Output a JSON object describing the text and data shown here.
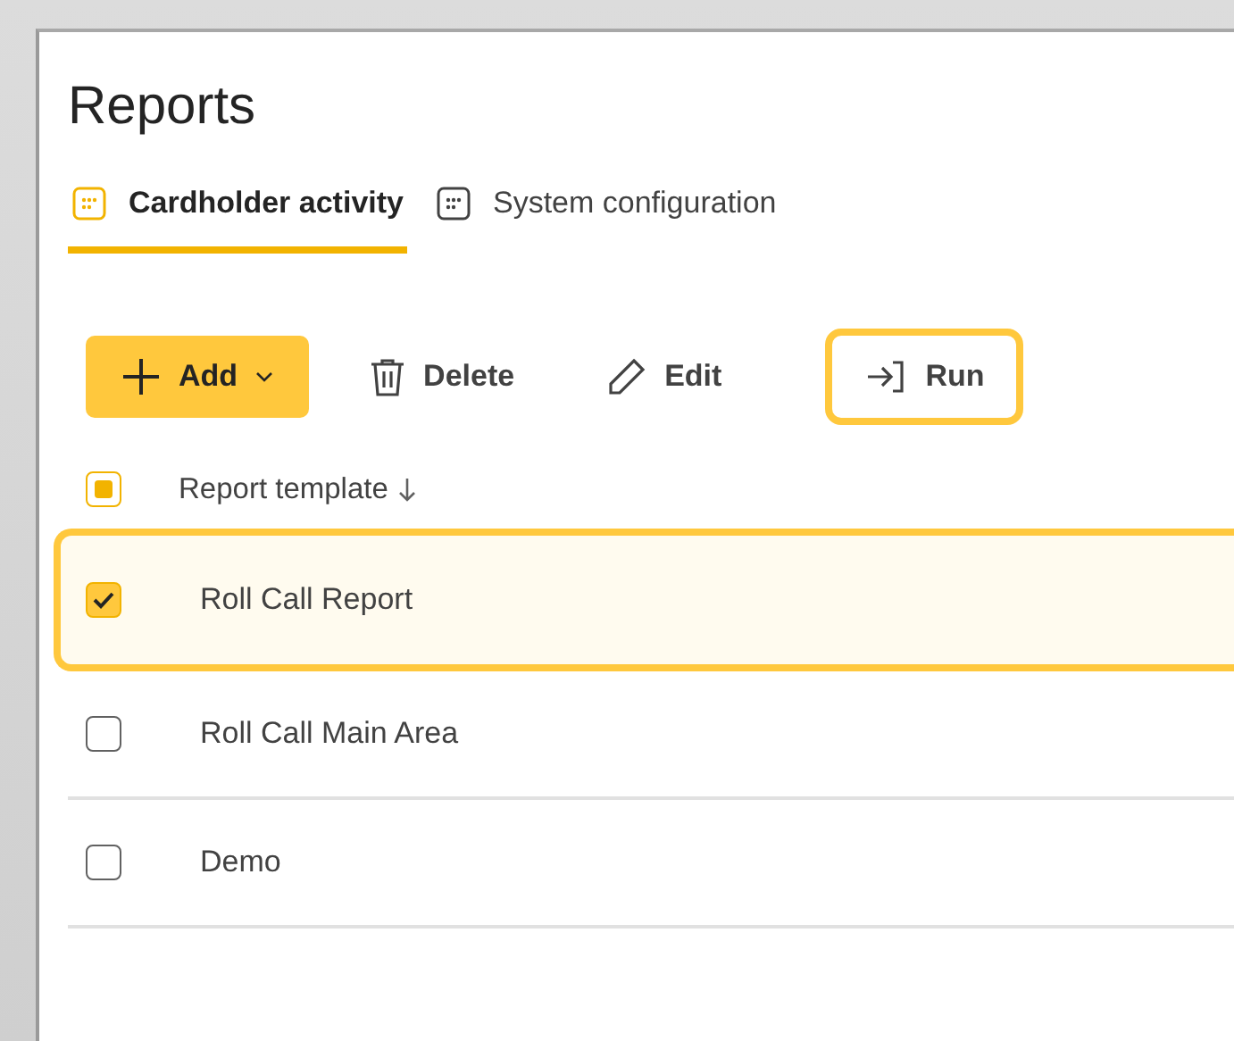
{
  "title": "Reports",
  "tabs": [
    {
      "label": "Cardholder activity",
      "selected": true
    },
    {
      "label": "System configuration",
      "selected": false
    }
  ],
  "toolbar": [
    {
      "kind": "add",
      "label": "Add",
      "focused": false
    },
    {
      "kind": "delete",
      "label": "Delete",
      "focused": false
    },
    {
      "kind": "edit",
      "label": "Edit",
      "focused": false
    },
    {
      "kind": "run",
      "label": "Run",
      "focused": true
    }
  ],
  "table": {
    "select_all": {
      "indeterminate": true
    },
    "column": "Report template",
    "sorted_descending": true,
    "rows": [
      {
        "name": "Roll Call Report",
        "selected": true
      },
      {
        "name": "Roll Call Main Area",
        "selected": false
      },
      {
        "name": "Demo",
        "selected": false
      }
    ]
  }
}
